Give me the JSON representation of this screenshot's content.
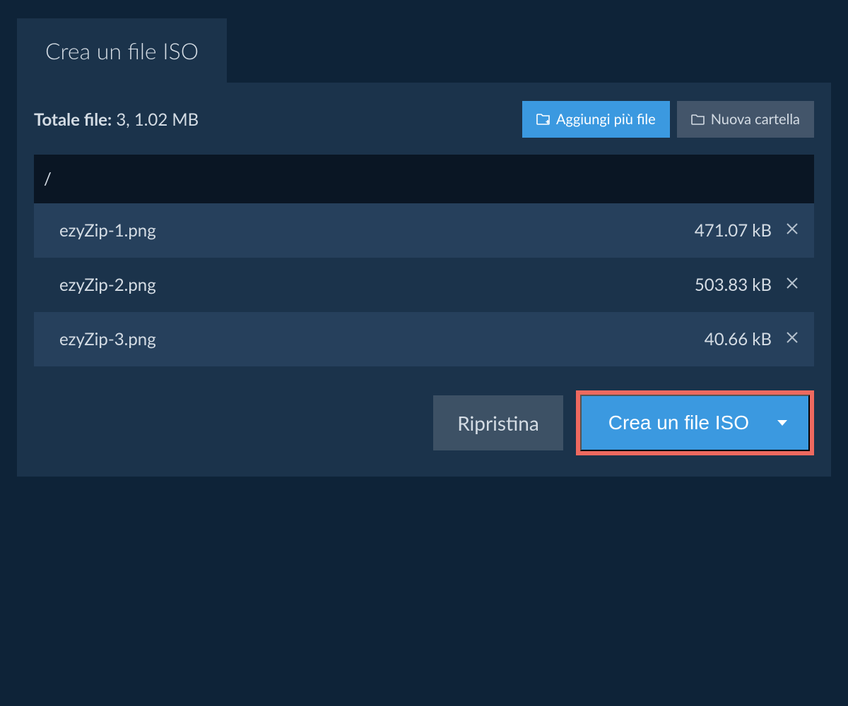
{
  "tab": {
    "label": "Crea un file ISO"
  },
  "summary": {
    "label": "Totale file:",
    "value": "3, 1.02 MB"
  },
  "buttons": {
    "add_files": "Aggiungi più file",
    "new_folder": "Nuova cartella",
    "reset": "Ripristina",
    "create": "Crea un file ISO"
  },
  "path": "/",
  "files": [
    {
      "name": "ezyZip-1.png",
      "size": "471.07 kB"
    },
    {
      "name": "ezyZip-2.png",
      "size": "503.83 kB"
    },
    {
      "name": "ezyZip-3.png",
      "size": "40.66 kB"
    }
  ]
}
